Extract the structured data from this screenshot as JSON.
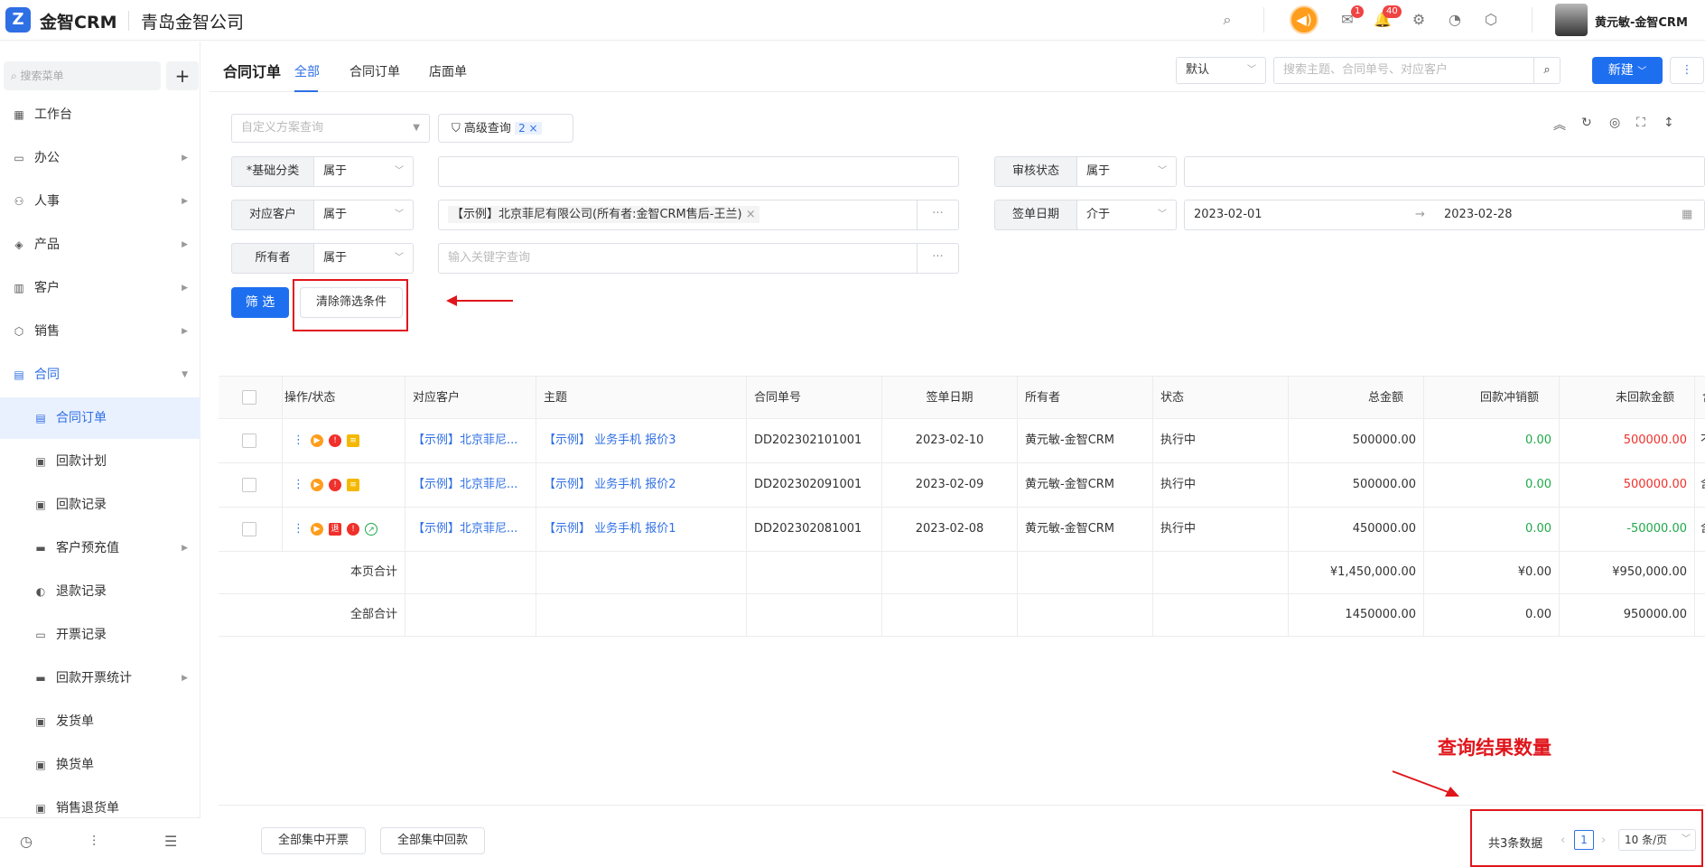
{
  "app": {
    "name": "金智CRM",
    "company": "青岛金智公司",
    "logo_glyph": "Z"
  },
  "topbar": {
    "icons": [
      "search-icon",
      "speaker-icon",
      "message-icon",
      "bell-icon",
      "gear-icon",
      "pie-chart-icon",
      "shield-icon"
    ],
    "message_badge": "1",
    "bell_badge": "40",
    "user_name": "黄元敏-金智CRM",
    "accent": "#ff9d1c"
  },
  "sidebar": {
    "search_placeholder": "搜索菜单",
    "plus": "+",
    "items": [
      {
        "label": "工作台",
        "icon": "dashboard-icon"
      },
      {
        "label": "办公",
        "icon": "monitor-icon"
      },
      {
        "label": "人事",
        "icon": "people-icon"
      },
      {
        "label": "产品",
        "icon": "cube-icon"
      },
      {
        "label": "客户",
        "icon": "chart-icon"
      },
      {
        "label": "销售",
        "icon": "box-icon"
      },
      {
        "label": "合同",
        "icon": "contract-icon"
      },
      {
        "label": "合同订单",
        "icon": "contract-icon"
      },
      {
        "label": "回款计划",
        "icon": "wallet-icon"
      },
      {
        "label": "回款记录",
        "icon": "wallet-icon"
      },
      {
        "label": "客户预充值",
        "icon": "folder-icon"
      },
      {
        "label": "退款记录",
        "icon": "refund-icon"
      },
      {
        "label": "开票记录",
        "icon": "printer-icon"
      },
      {
        "label": "回款开票统计",
        "icon": "folder-icon"
      },
      {
        "label": "发货单",
        "icon": "package-icon"
      },
      {
        "label": "换货单",
        "icon": "package-icon"
      },
      {
        "label": "销售退货单",
        "icon": "package-icon"
      }
    ]
  },
  "header": {
    "title": "合同订单",
    "tabs": [
      "全部",
      "合同订单",
      "店面单"
    ],
    "view_select": "默认",
    "search_placeholder": "搜索主题、合同单号、对应客户",
    "new_button": "新建",
    "more_button": "⋮"
  },
  "filter": {
    "scheme_placeholder": "自定义方案查询",
    "advanced_label": "高级查询",
    "advanced_count": "2",
    "rows": [
      {
        "label": "*基础分类",
        "op": "属于",
        "value": ""
      },
      {
        "label": "审核状态",
        "op": "属于",
        "value": ""
      },
      {
        "label": "对应客户",
        "op": "属于",
        "value": "【示例】北京菲尼有限公司(所有者:金智CRM售后-王兰)"
      },
      {
        "label": "签单日期",
        "op": "介于",
        "from": "2023-02-01",
        "to": "2023-02-28"
      },
      {
        "label": "所有者",
        "op": "属于",
        "placeholder": "输入关键字查询"
      }
    ],
    "filter_button": "筛 选",
    "clear_button": "清除筛选条件",
    "dots": "···"
  },
  "table": {
    "columns": [
      "操作/状态",
      "对应客户",
      "主题",
      "合同单号",
      "签单日期",
      "所有者",
      "状态",
      "总金额",
      "回款冲销额",
      "未回款金额",
      "含"
    ],
    "rows": [
      {
        "customer": "【示例】北京菲尼...",
        "subject": "【示例】 业务手机 报价3",
        "no": "DD202302101001",
        "date": "2023-02-10",
        "owner": "黄元敏-金智CRM",
        "status": "执行中",
        "total": "500000.00",
        "offset": "0.00",
        "unpaid": "500000.00",
        "extra": "不"
      },
      {
        "customer": "【示例】北京菲尼...",
        "subject": "【示例】 业务手机 报价2",
        "no": "DD202302091001",
        "date": "2023-02-09",
        "owner": "黄元敏-金智CRM",
        "status": "执行中",
        "total": "500000.00",
        "offset": "0.00",
        "unpaid": "500000.00",
        "extra": "含"
      },
      {
        "customer": "【示例】北京菲尼...",
        "subject": "【示例】 业务手机 报价1",
        "no": "DD202302081001",
        "date": "2023-02-08",
        "owner": "黄元敏-金智CRM",
        "status": "执行中",
        "total": "450000.00",
        "offset": "0.00",
        "unpaid": "-50000.00",
        "extra": "含"
      }
    ],
    "page_total": {
      "label": "本页合计",
      "total": "¥1,450,000.00",
      "offset": "¥0.00",
      "unpaid": "¥950,000.00"
    },
    "all_total": {
      "label": "全部合计",
      "total": "1450000.00",
      "offset": "0.00",
      "unpaid": "950000.00"
    }
  },
  "footer": {
    "btn_invoice": "全部集中开票",
    "btn_payment": "全部集中回款",
    "count": "共3条数据",
    "page": "1",
    "page_size": "10 条/页"
  },
  "annotation": {
    "text": "查询结果数量",
    "color": "#e0161c"
  }
}
